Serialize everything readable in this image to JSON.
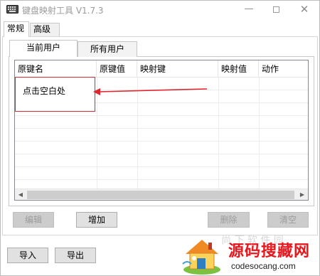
{
  "window": {
    "title": "键盘映射工具 V1.7.3",
    "controls": {
      "minimize": "—",
      "maximize": "",
      "close": "✕"
    }
  },
  "outer_tabs": [
    {
      "label": "常规",
      "active": true
    },
    {
      "label": "高级",
      "active": false
    }
  ],
  "inner_tabs": [
    {
      "label": "当前用户",
      "active": true
    },
    {
      "label": "所有用户",
      "active": false
    }
  ],
  "table": {
    "columns": [
      "原键名",
      "原键值",
      "映射键",
      "映射值",
      "动作"
    ],
    "rows": []
  },
  "annotation": {
    "hint": "点击空白处",
    "color": "#e0252f"
  },
  "buttons": {
    "edit": "编辑",
    "add": "增加",
    "delete": "删除",
    "clear": "清空",
    "import": "导入",
    "export": "导出"
  },
  "watermark": {
    "title": "源码搜藏网",
    "url": "codesocang.com",
    "faded": "尚 下 软 件 园",
    "color": "#e8161c"
  },
  "icons": {
    "app": "keyboard-icon",
    "scroll_left": "chevron-left-icon",
    "scroll_right": "chevron-right-icon"
  }
}
